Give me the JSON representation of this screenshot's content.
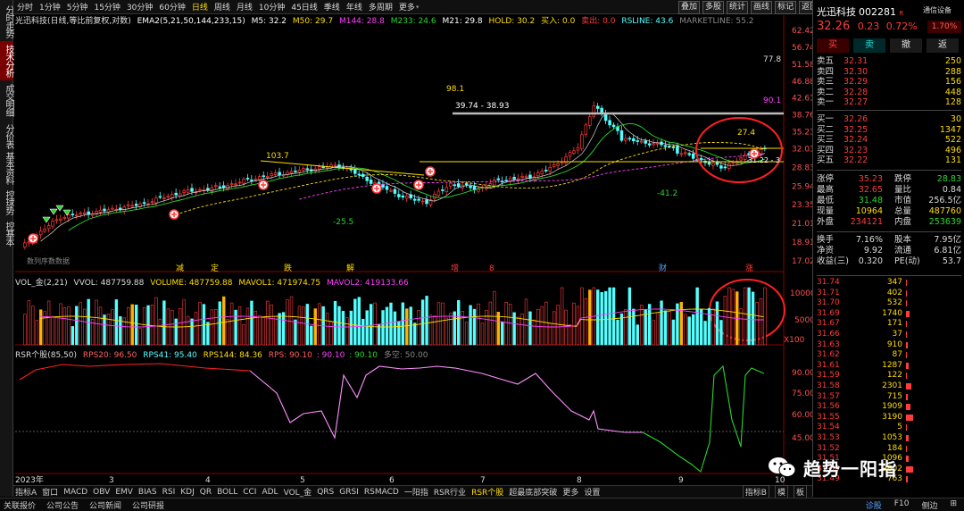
{
  "left_nav": [
    "分时走势",
    "技术分析",
    "成交明细",
    "分价表",
    "基本资料",
    "控球势",
    "控基本"
  ],
  "left_nav_active": 1,
  "periods": [
    "分时",
    "1分钟",
    "5分钟",
    "15分钟",
    "30分钟",
    "60分钟",
    "日线",
    "周线",
    "月线",
    "10分钟",
    "45日线",
    "季线",
    "年线",
    "多周期",
    "更多"
  ],
  "period_active": "日线",
  "tools": [
    "叠加",
    "多股",
    "统计",
    "画线",
    "标记",
    "返回"
  ],
  "legend_main": {
    "name": "光迅科技(日线,等比前复权,对数)",
    "ema": "EMA2(5,21,50,144,233,15)",
    "m5": "M5: 32.2",
    "m50": "M50: 29.7",
    "m144": "M144: 28.8",
    "m233": "M233: 24.6",
    "m21": "M21: 29.8",
    "hold": "HOLD: 30.2",
    "buy": "买入: 0.0",
    "sell": "卖出: 0.0",
    "rsline": "RSLINE: 43.6",
    "mktline": "MARKETLINE: 55.2"
  },
  "legend_vol": {
    "name": "VOL_金(2,21)",
    "vvol": "VVOL: 487759.88",
    "volume": "VOLUME: 487759.88",
    "mavol1": "MAVOL1: 471974.75",
    "mavol2": "MAVOL2: 419133.66"
  },
  "legend_rsr": {
    "name": "RSR个股(85,50)",
    "rps20": "RPS20: 96.50",
    "rps41": "RPS41: 95.40",
    "rps144": "RPS144: 84.36",
    "rps": "RPS: 90.10",
    "a": ": 90.10",
    "b": ": 90.10",
    "c": "多空: 50.00"
  },
  "price_axis": [
    "62.42",
    "56.74",
    "51.58",
    "46.88",
    "42.63",
    "38.76",
    "35.23",
    "32.03",
    "28.83",
    "25.94",
    "23.35",
    "21.01",
    "18.91",
    "17.02"
  ],
  "vol_axis": [
    "10000",
    "5000",
    "X100"
  ],
  "rsr_axis": [
    "90.00",
    "75.00",
    "60.00",
    "45.00"
  ],
  "x_axis": [
    "2023年",
    "3",
    "4",
    "5",
    "6",
    "7",
    "8",
    "9",
    "10"
  ],
  "annotations": {
    "hi": "98.1",
    "r1": "77.8",
    "r2": "90.1",
    "a1": "103.7",
    "a2": "-25.5",
    "a3": "-41.2",
    "range": "39.74 - 38.93",
    "n274": "27.4",
    "n312": "31.22 - 3",
    "small": "数列序数数据"
  },
  "event_labels": [
    "减",
    "定",
    "跌",
    "解",
    "增",
    "8",
    "财",
    "涨"
  ],
  "stock": {
    "name": "光迅科技",
    "code": "002281",
    "r": "R",
    "price": "32.26",
    "change": "0.23",
    "pct": "0.72%",
    "tongxin": "通信设备",
    "pct_badge": "1.70%"
  },
  "order_buttons": [
    "买",
    "卖",
    "撤",
    "返"
  ],
  "asks": [
    {
      "l": "卖五",
      "p": "32.31",
      "v": "250"
    },
    {
      "l": "卖四",
      "p": "32.30",
      "v": "288"
    },
    {
      "l": "卖三",
      "p": "32.29",
      "v": "156"
    },
    {
      "l": "卖二",
      "p": "32.28",
      "v": "448"
    },
    {
      "l": "卖一",
      "p": "32.27",
      "v": "128"
    }
  ],
  "bids": [
    {
      "l": "买一",
      "p": "32.26",
      "v": "30"
    },
    {
      "l": "买二",
      "p": "32.25",
      "v": "1347"
    },
    {
      "l": "买三",
      "p": "32.24",
      "v": "522"
    },
    {
      "l": "买四",
      "p": "32.23",
      "v": "496"
    },
    {
      "l": "买五",
      "p": "32.22",
      "v": "131"
    }
  ],
  "info": [
    [
      "涨停",
      "35.23",
      "跌停",
      "28.83"
    ],
    [
      "最高",
      "32.65",
      "量比",
      "0.84"
    ],
    [
      "最低",
      "31.48",
      "市值",
      "256.5亿"
    ],
    [
      "现量",
      "10964",
      "总量",
      "487760"
    ],
    [
      "外盘",
      "234121",
      "内盘",
      "253639"
    ],
    [
      "换手",
      "7.16%",
      "股本",
      "7.95亿"
    ],
    [
      "净资",
      "9.92",
      "流通",
      "6.81亿"
    ],
    [
      "收益(三)",
      "0.320",
      "PE(动)",
      "53.7"
    ]
  ],
  "ticks": [
    {
      "p": "31.74",
      "v": "347"
    },
    {
      "p": "31.71",
      "v": "402"
    },
    {
      "p": "31.70",
      "v": "532"
    },
    {
      "p": "31.69",
      "v": "1740"
    },
    {
      "p": "31.67",
      "v": "171"
    },
    {
      "p": "31.66",
      "v": "37"
    },
    {
      "p": "31.63",
      "v": "910"
    },
    {
      "p": "31.62",
      "v": "87"
    },
    {
      "p": "31.61",
      "v": "1287"
    },
    {
      "p": "31.59",
      "v": "122"
    },
    {
      "p": "31.58",
      "v": "2301"
    },
    {
      "p": "31.57",
      "v": "715"
    },
    {
      "p": "31.56",
      "v": "1909"
    },
    {
      "p": "31.55",
      "v": "3190"
    },
    {
      "p": "31.54",
      "v": "5"
    },
    {
      "p": "31.53",
      "v": "1053"
    },
    {
      "p": "31.52",
      "v": "184"
    },
    {
      "p": "31.51",
      "v": "1096"
    },
    {
      "p": "31.50",
      "v": "9802"
    },
    {
      "p": "31.49",
      "v": "763"
    }
  ],
  "bottom_tabs": [
    "指标A",
    "窗口",
    "MACD",
    "OBV",
    "EMV",
    "BIAS",
    "RSI",
    "KDJ",
    "QR",
    "BOLL",
    "CCI",
    "ADL",
    "VOL_金",
    "QRS",
    "GRSI",
    "RSMACD",
    "一阳指",
    "RSR行业",
    "RSR个股",
    "超最底部突破",
    "更多",
    "设置"
  ],
  "bottom_active": "RSR个股",
  "bottom_right": [
    "指标B",
    "模",
    "板"
  ],
  "status": [
    "关联报价",
    "公司公告",
    "公司新闻",
    "公司研报"
  ],
  "status_right": [
    "诊股",
    "F10",
    "侧边",
    "⊞"
  ],
  "watermark": "趋势一阳指",
  "colors": {
    "up": "#ff3b3b",
    "down": "#54ffff",
    "yellow": "#ffde00",
    "magenta": "#ff40ff",
    "green": "#2bd62b",
    "bg": "#000000"
  }
}
